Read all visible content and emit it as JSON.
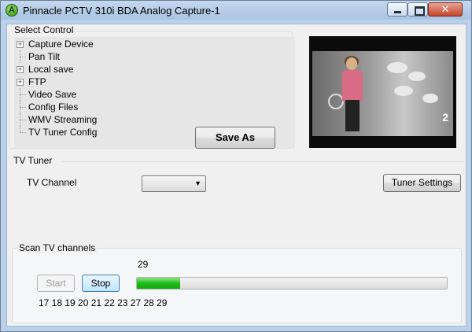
{
  "window": {
    "title": "Pinnacle PCTV 310i BDA Analog Capture-1",
    "app_icon_letter": "A",
    "buttons": {
      "minimize_icon": "minimize-icon",
      "maximize_icon": "maximize-icon",
      "close_icon": "close-icon",
      "close_glyph": "✕"
    }
  },
  "select_control": {
    "legend": "Select Control",
    "items": [
      {
        "label": "Capture Device",
        "expandable": true
      },
      {
        "label": "Pan Tilt",
        "expandable": false
      },
      {
        "label": "Local save",
        "expandable": true
      },
      {
        "label": "FTP",
        "expandable": true
      },
      {
        "label": "Video Save",
        "expandable": false
      },
      {
        "label": "Config Files",
        "expandable": false
      },
      {
        "label": "WMV Streaming",
        "expandable": false
      },
      {
        "label": "TV Tuner Config",
        "expandable": false
      }
    ],
    "save_as_label": "Save As"
  },
  "preview": {
    "channel_logo": "2"
  },
  "tv_tuner": {
    "legend": "TV Tuner",
    "channel_label": "TV Channel",
    "channel_value": "",
    "tuner_settings_label": "Tuner Settings"
  },
  "scan": {
    "legend": "Scan TV channels",
    "current_channel": "29",
    "start_label": "Start",
    "stop_label": "Stop",
    "progress_fraction": 0.14,
    "found_channels": "17 18 19 20 21 22 23 27 28 29"
  }
}
